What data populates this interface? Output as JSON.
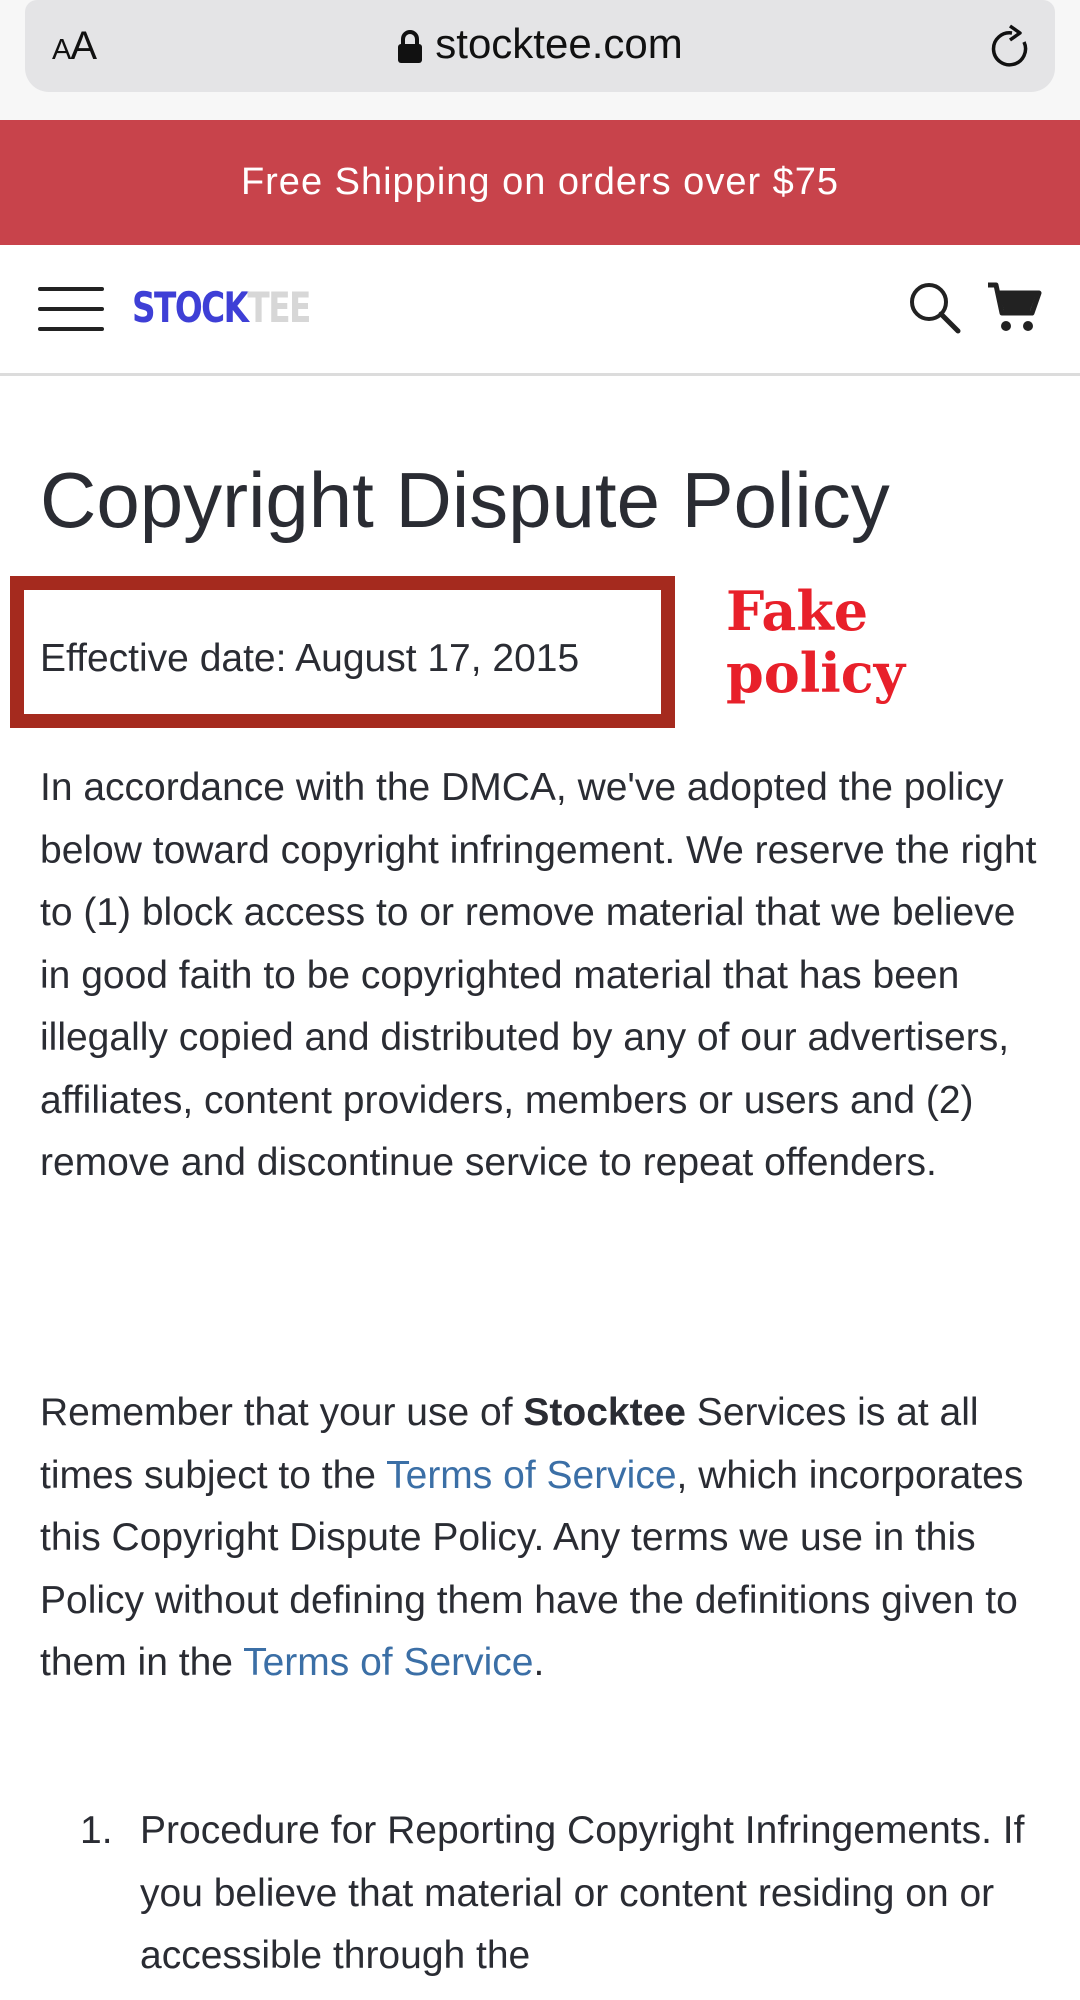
{
  "browser": {
    "text_size_label_small": "A",
    "text_size_label_large": "A",
    "url": "stocktee.com"
  },
  "promo": {
    "text": "Free Shipping on orders over $75"
  },
  "header": {
    "logo_part1": "STOCK",
    "logo_part2": "TEE"
  },
  "colors": {
    "promo_bg": "#c8434b",
    "logo_accent": "#3e3fd6",
    "link": "#3b6fa6",
    "annotation_red": "#e8202a",
    "box_border": "#a52a1e"
  },
  "page": {
    "title": "Copyright Dispute Policy",
    "effective_date": "Effective date: August 17, 2015",
    "annotation_line1": "Fake",
    "annotation_line2": "policy",
    "para1": "In accordance with the DMCA, we've adopted the policy below toward copyright infringement. We reserve the right to (1) block access to or remove material that we believe in good faith to be copyrighted material that has been illegally copied and distributed by any of our advertisers, affiliates, content providers, members or users and (2) remove and discontinue service to repeat offenders.",
    "para2_a": "Remember that your use of ",
    "para2_brand": "Stocktee",
    "para2_b": " Services is at all times subject to the ",
    "para2_link1": "Terms of Service",
    "para2_c": ", which incorporates this Copyright Dispute Policy. Any terms we use in this Policy without defining them have the definitions given to them in the ",
    "para2_link2": "Terms of Service",
    "para2_d": ".",
    "list_number": "1.",
    "list_text": "Procedure for Reporting Copyright Infringements. If you believe that material or content residing on or accessible through the"
  },
  "icons": [
    "lock-icon",
    "reload-icon",
    "hamburger-icon",
    "search-icon",
    "cart-icon"
  ]
}
